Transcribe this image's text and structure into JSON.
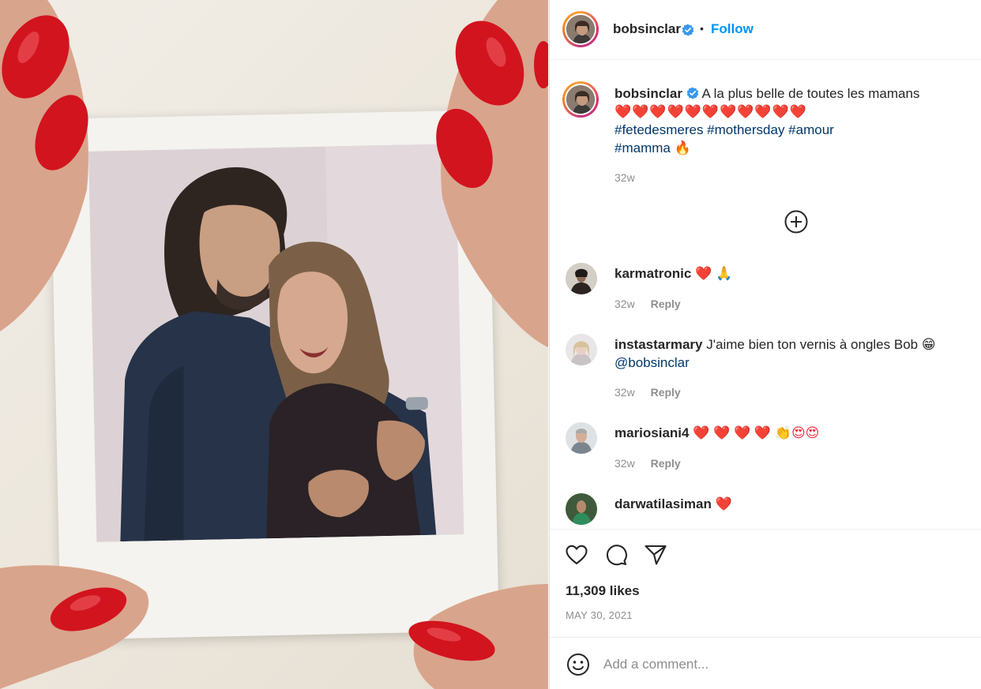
{
  "post": {
    "username": "bobsinclar",
    "follow_label": "Follow",
    "separator": "•"
  },
  "caption": {
    "username": "bobsinclar",
    "text": "A la plus belle de toutes les mamans",
    "hearts": "❤️❤️❤️❤️❤️❤️❤️❤️❤️❤️❤️",
    "hashtags_line1": "#fetedesmeres #mothersday #amour",
    "hashtags_line2": "#mamma",
    "line2_emoji": "🔥",
    "time": "32w"
  },
  "comments": [
    {
      "username": "karmatronic",
      "text": "❤️ 🙏",
      "time": "32w",
      "reply": "Reply"
    },
    {
      "username": "instastarmary",
      "text": "J'aime bien ton vernis à ongles Bob 😁",
      "mention": "@bobsinclar",
      "time": "32w",
      "reply": "Reply"
    },
    {
      "username": "mariosiani4",
      "text": "❤️ ❤️ ❤️ ❤️ 👏😍😍",
      "time": "32w",
      "reply": "Reply"
    },
    {
      "username": "darwatilasiman",
      "text": "❤️"
    }
  ],
  "footer": {
    "likes": "11,309 likes",
    "date": "MAY 30, 2021",
    "comment_placeholder": "Add a comment..."
  },
  "colors": {
    "link": "#0095f6",
    "hashtag": "#00376b",
    "heart": "#ed2b3b",
    "nail": "#d2141e",
    "muted": "#8e8e8e"
  },
  "icons": [
    "verified-badge-icon",
    "load-more-comments-icon",
    "like-heart-icon",
    "comment-icon",
    "share-icon",
    "emoji-icon"
  ]
}
